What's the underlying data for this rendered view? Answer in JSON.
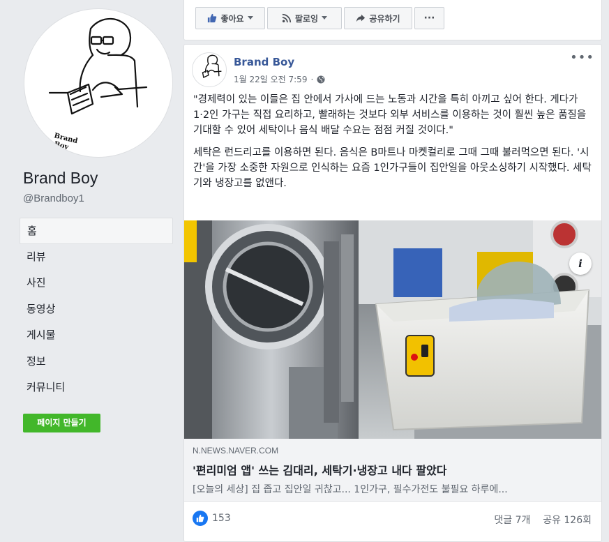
{
  "page": {
    "name": "Brand Boy",
    "handle": "@Brandboy1",
    "logo_text": "Brand\nBoy"
  },
  "nav": {
    "items": [
      {
        "label": "홈",
        "active": true
      },
      {
        "label": "리뷰"
      },
      {
        "label": "사진"
      },
      {
        "label": "동영상"
      },
      {
        "label": "게시물"
      },
      {
        "label": "정보"
      },
      {
        "label": "커뮤니티"
      }
    ],
    "create_page": "페이지 만들기"
  },
  "actions": {
    "like": "좋아요",
    "follow": "팔로잉",
    "share": "공유하기",
    "more": "···"
  },
  "post": {
    "author": "Brand Boy",
    "time": "1월 22일 오전 7:59",
    "privacy_icon": "globe-icon",
    "paragraph1": "\"경제력이 있는 이들은 집 안에서 가사에 드는 노동과 시간을 특히 아끼고 싶어 한다. 게다가 1·2인 가구는 직접 요리하고, 빨래하는 것보다 외부 서비스를 이용하는 것이 훨씬 높은 품질을 기대할 수 있어 세탁이나 음식 배달 수요는 점점 커질 것이다.\"",
    "paragraph2": "세탁은 런드리고를 이용하면 된다. 음식은 B마트나 마켓컬리로 그때 그때 불러먹으면 된다. '시간'을 가장 소중한 자원으로 인식하는 요즘 1인가구들이 집안일을 아웃소싱하기 시작했다. 세탁기와 냉장고를 없앤다.",
    "link": {
      "domain": "n.news.naver.com",
      "title": "'편리미엄 앱' 쓰는 김대리, 세탁기·냉장고 내다 팔았다",
      "description": "[오늘의 세상] 집 좁고 집안일 귀찮고... 1인가구, 필수가전도 불필요 하루에..."
    },
    "reactions_count": "153",
    "comments": "댓글 7개",
    "shares": "공유 126회"
  },
  "colors": {
    "brand_blue": "#385898",
    "green_button": "#42b72a",
    "like_blue": "#1877f2"
  }
}
